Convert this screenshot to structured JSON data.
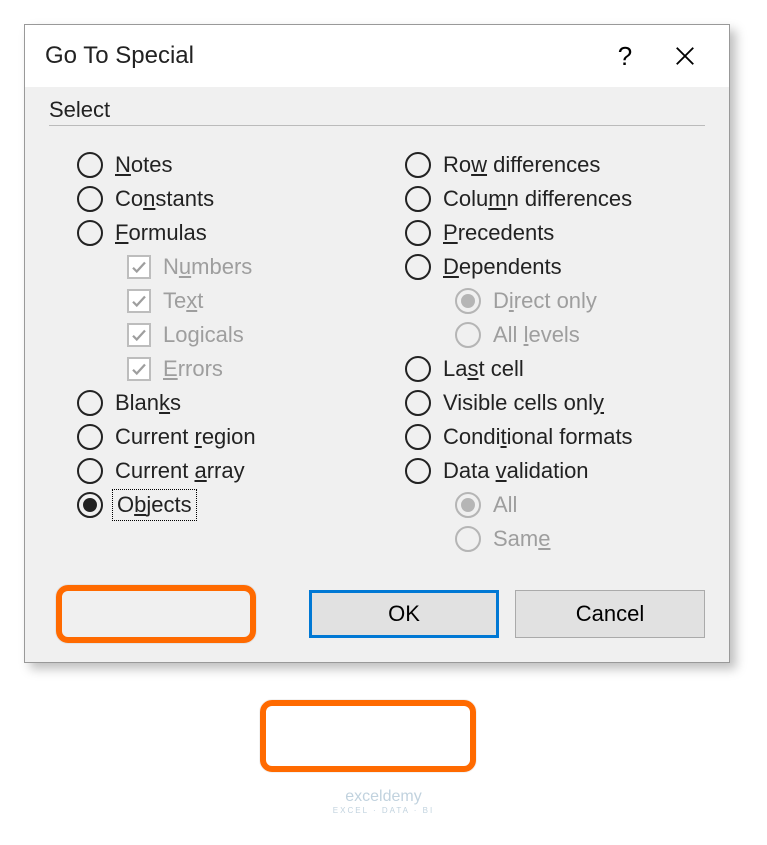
{
  "dialog": {
    "title": "Go To Special",
    "help_symbol": "?",
    "legend": "Select",
    "left_options": [
      {
        "label_html": "<span class='underline-char'>N</span>otes",
        "type": "radio"
      },
      {
        "label_html": "Co<span class='underline-char'>n</span>stants",
        "type": "radio"
      },
      {
        "label_html": "<span class='underline-char'>F</span>ormulas",
        "type": "radio"
      },
      {
        "label_html": "N<span class='underline-char'>u</span>mbers",
        "type": "check",
        "sub": true,
        "disabled": true,
        "checked": true
      },
      {
        "label_html": "Te<span class='underline-char'>x</span>t",
        "type": "check",
        "sub": true,
        "disabled": true,
        "checked": true
      },
      {
        "label_html": "Lo<span class='underline-char'>g</span>icals",
        "type": "check",
        "sub": true,
        "disabled": true,
        "checked": true
      },
      {
        "label_html": "<span class='underline-char'>E</span>rrors",
        "type": "check",
        "sub": true,
        "disabled": true,
        "checked": true
      },
      {
        "label_html": "Blan<span class='underline-char'>k</span>s",
        "type": "radio"
      },
      {
        "label_html": "Current <span class='underline-char'>r</span>egion",
        "type": "radio"
      },
      {
        "label_html": "Current <span class='underline-char'>a</span>rray",
        "type": "radio"
      },
      {
        "label_html": "O<span class='underline-char'>b</span>jects",
        "type": "radio",
        "checked": true,
        "focused": true
      }
    ],
    "right_options": [
      {
        "label_html": "Ro<span class='underline-char'>w</span> differences",
        "type": "radio"
      },
      {
        "label_html": "Colu<span class='underline-char'>m</span>n differences",
        "type": "radio"
      },
      {
        "label_html": "<span class='underline-char'>P</span>recedents",
        "type": "radio"
      },
      {
        "label_html": "<span class='underline-char'>D</span>ependents",
        "type": "radio"
      },
      {
        "label_html": "D<span class='underline-char'>i</span>rect only",
        "type": "radio",
        "sub": true,
        "disabled": true,
        "checked": true
      },
      {
        "label_html": "All <span class='underline-char'>l</span>evels",
        "type": "radio",
        "sub": true,
        "disabled": true
      },
      {
        "label_html": "La<span class='underline-char'>s</span>t cell",
        "type": "radio"
      },
      {
        "label_html": "Visible cells onl<span class='underline-char'>y</span>",
        "type": "radio"
      },
      {
        "label_html": "Condi<span class='underline-char'>t</span>ional formats",
        "type": "radio"
      },
      {
        "label_html": "Data <span class='underline-char'>v</span>alidation",
        "type": "radio"
      },
      {
        "label_html": "All",
        "type": "radio",
        "sub": true,
        "disabled": true,
        "checked": true
      },
      {
        "label_html": "Sam<span class='underline-char'>e</span>",
        "type": "radio",
        "sub": true,
        "disabled": true
      }
    ],
    "buttons": {
      "ok": "OK",
      "cancel": "Cancel"
    }
  },
  "watermark": {
    "brand": "exceldemy",
    "tag": "EXCEL · DATA · BI"
  }
}
